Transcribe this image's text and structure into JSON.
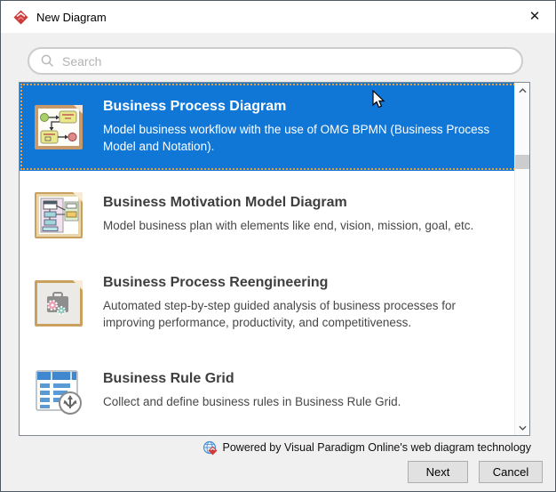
{
  "window": {
    "title": "New Diagram",
    "close_glyph": "✕"
  },
  "search": {
    "placeholder": "Search",
    "value": ""
  },
  "list": {
    "items": [
      {
        "title": "Business Process Diagram",
        "description": "Model business workflow with the use of OMG BPMN (Business Process Model and Notation).",
        "icon": "bpmn-diagram-icon",
        "selected": true
      },
      {
        "title": "Business Motivation Model Diagram",
        "description": "Model business plan with elements like end, vision, mission, goal, etc.",
        "icon": "business-motivation-model-icon",
        "selected": false
      },
      {
        "title": "Business Process Reengineering",
        "description": "Automated step-by-step guided analysis of business processes for improving performance, productivity, and competitiveness.",
        "icon": "business-process-reengineering-icon",
        "selected": false
      },
      {
        "title": "Business Rule Grid",
        "description": "Collect and define business rules in Business Rule Grid.",
        "icon": "business-rule-grid-icon",
        "selected": false
      }
    ]
  },
  "footer": {
    "powered_by": "Powered by Visual Paradigm Online's web diagram technology",
    "next_label": "Next",
    "cancel_label": "Cancel"
  },
  "colors": {
    "selection_blue": "#1177d7",
    "focus_outline_orange": "#f09e3c",
    "brand_red": "#cc3a3a",
    "body_gray": "#f0f0f0"
  }
}
